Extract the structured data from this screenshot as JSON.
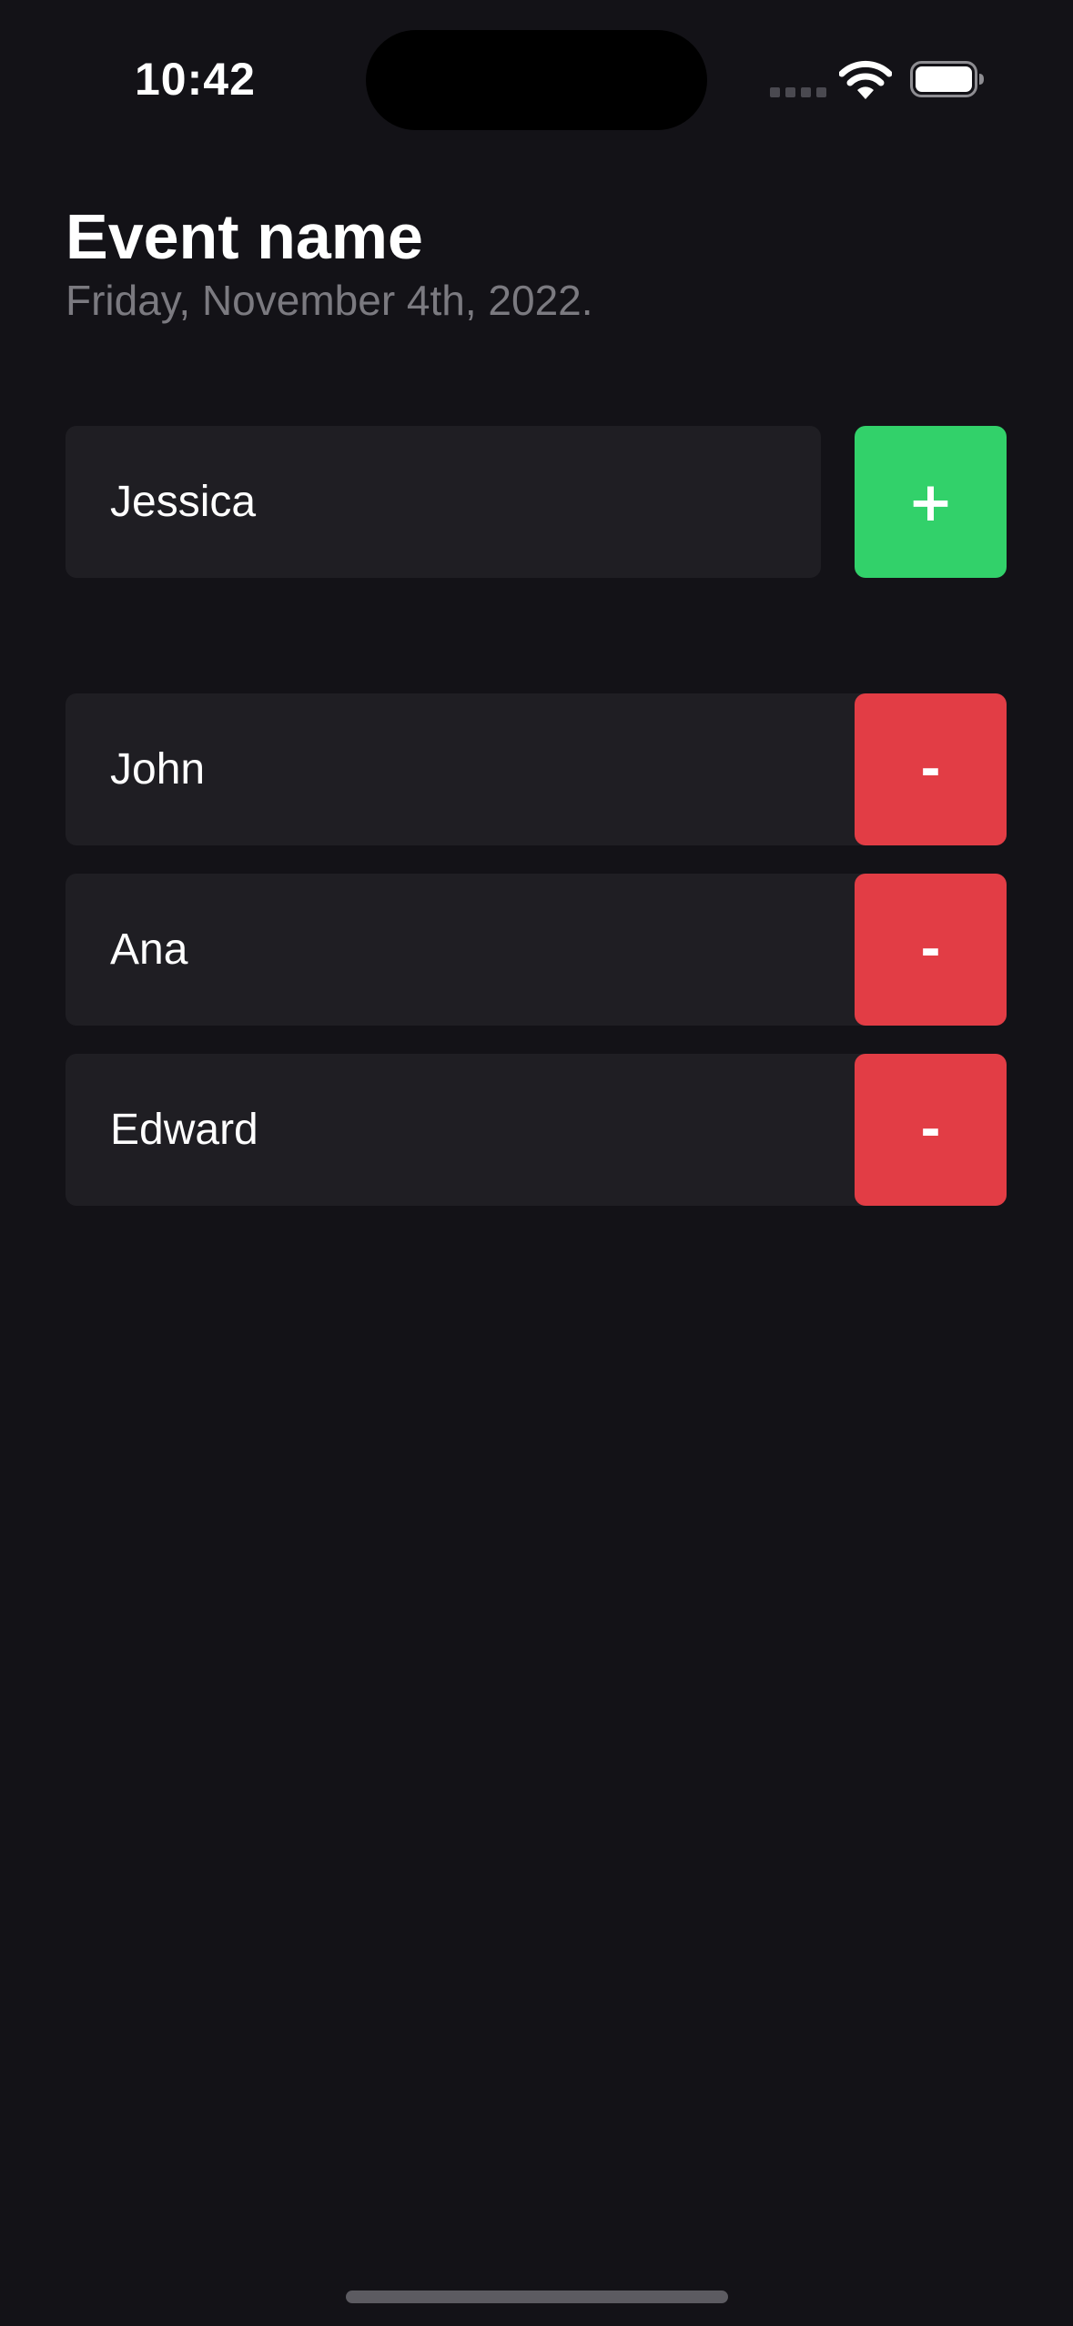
{
  "status_bar": {
    "time": "10:42",
    "icons": [
      "cellular-signal-icon",
      "wifi-icon",
      "battery-icon"
    ]
  },
  "header": {
    "title": "Event name",
    "date": "Friday, November 4th, 2022."
  },
  "new_guest": {
    "value": "Jessica",
    "add_label": "+"
  },
  "guests": [
    {
      "name": "John",
      "remove_label": "-"
    },
    {
      "name": "Ana",
      "remove_label": "-"
    },
    {
      "name": "Edward",
      "remove_label": "-"
    }
  ],
  "colors": {
    "background": "#131217",
    "card": "#1f1e23",
    "add": "#32d16a",
    "remove": "#e23d45",
    "secondary_text": "#7b7a80"
  }
}
